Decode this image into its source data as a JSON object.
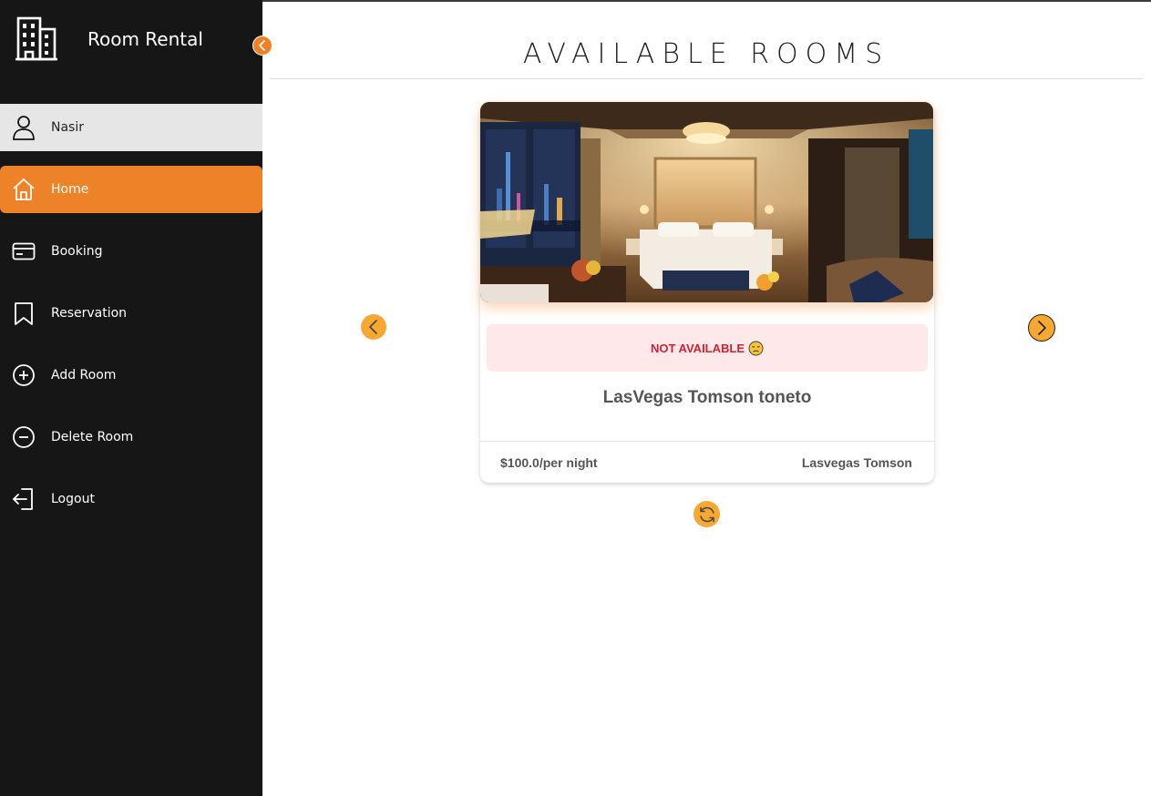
{
  "app": {
    "title": "Room Rental",
    "logo_icon": "building-icon",
    "collapse_icon": "chevron-left-icon"
  },
  "user": {
    "name": "Nasir",
    "icon": "user-icon"
  },
  "sidebar": {
    "items": [
      {
        "label": "Home",
        "icon": "home-icon",
        "active": true
      },
      {
        "label": "Booking",
        "icon": "credit-card-icon",
        "active": false
      },
      {
        "label": "Reservation",
        "icon": "bookmark-icon",
        "active": false
      },
      {
        "label": "Add Room",
        "icon": "plus-circle-icon",
        "active": false
      },
      {
        "label": "Delete Room",
        "icon": "minus-circle-icon",
        "active": false
      },
      {
        "label": "Logout",
        "icon": "logout-icon",
        "active": false
      }
    ]
  },
  "main": {
    "title": "AVAILABLE ROOMS",
    "room": {
      "status": "NOT AVAILABLE",
      "status_emoji": "disappointed-face-icon",
      "name": "LasVegas Tomson toneto",
      "price": "$100.0/per night",
      "location": "Lasvegas Tomson"
    },
    "controls": {
      "prev_icon": "chevron-left-icon",
      "next_icon": "chevron-right-icon",
      "refresh_icon": "refresh-icon"
    }
  },
  "colors": {
    "accent": "#ee8228",
    "arrow": "#f6a832",
    "sidebar_bg": "#161616",
    "status_bg": "#fee8ea",
    "status_text": "#cc2233"
  }
}
